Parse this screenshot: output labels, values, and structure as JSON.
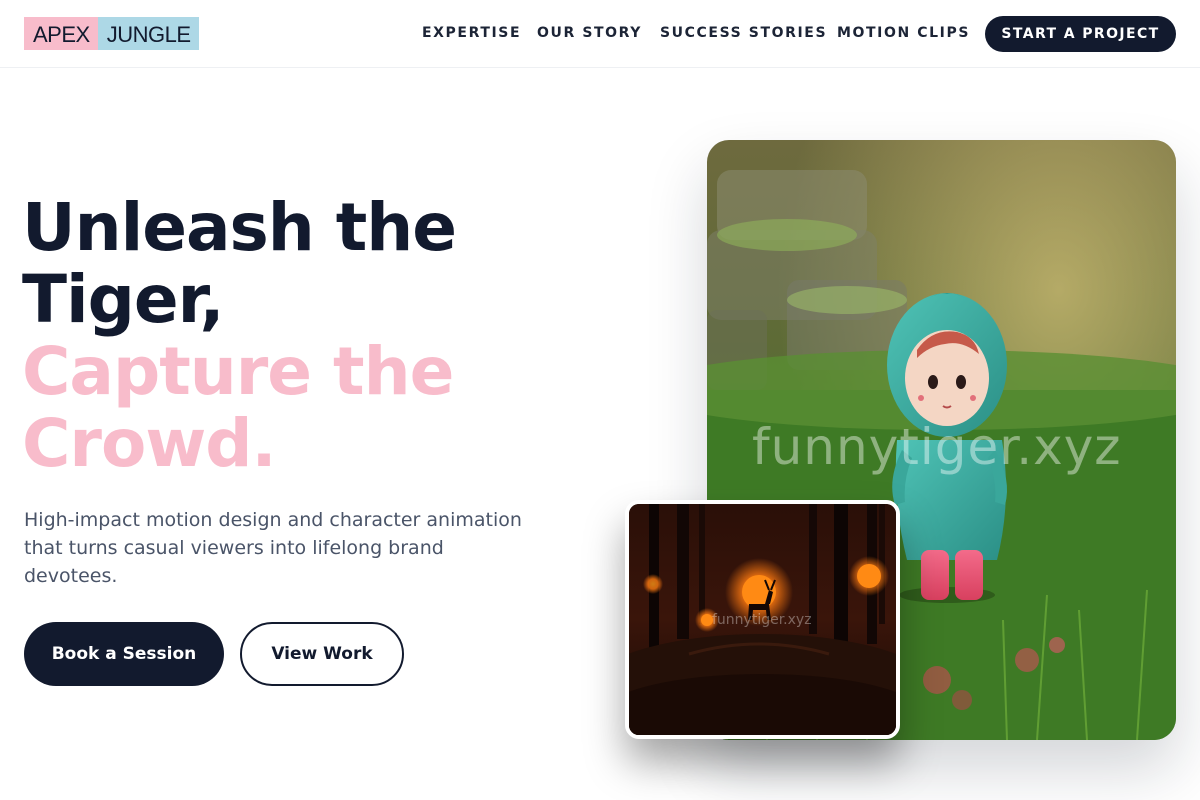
{
  "header": {
    "logo": {
      "part1": "APEX",
      "part2": "JUNGLE"
    },
    "nav": [
      {
        "label": "EXPERTISE"
      },
      {
        "label": "OUR STORY"
      },
      {
        "label": "SUCCESS STORIES"
      },
      {
        "label": "MOTION CLIPS"
      }
    ],
    "cta_label": "START A PROJECT"
  },
  "hero": {
    "headline": {
      "line1": "Unleash the",
      "line2": "Tiger,",
      "line3": "Capture the",
      "line4": "Crowd."
    },
    "subtext": "High-impact motion design and character animation that turns casual viewers into lifelong brand devotees.",
    "primary_button": "Book a Session",
    "secondary_button": "View Work",
    "main_image_watermark": "funnytiger.xyz",
    "inset_image_watermark": "funnytiger.xyz"
  },
  "colors": {
    "navy": "#121a2e",
    "pink": "#f8bccb",
    "light_blue": "#add8e6",
    "body_text": "#4a5468"
  }
}
